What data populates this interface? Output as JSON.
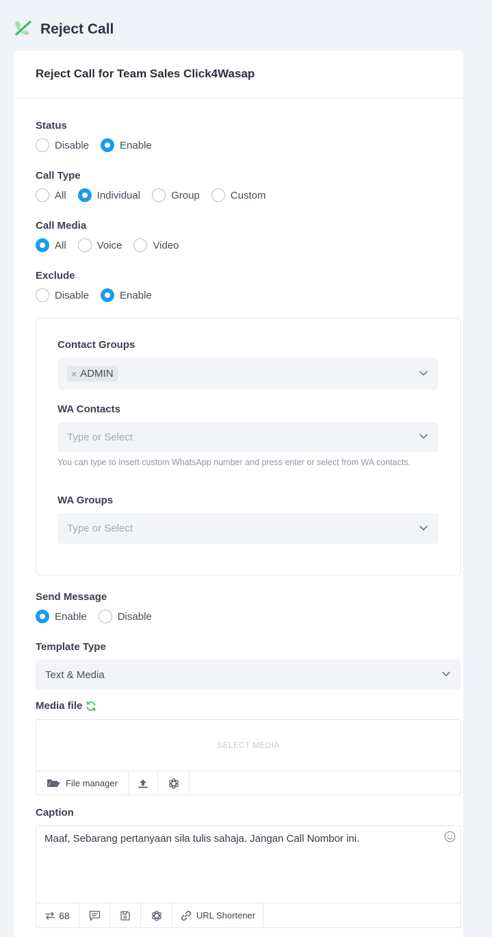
{
  "page": {
    "title": "Reject Call"
  },
  "card": {
    "title": "Reject Call for Team Sales Click4Wasap"
  },
  "status": {
    "label": "Status",
    "options": [
      "Disable",
      "Enable"
    ],
    "selected": "Enable"
  },
  "call_type": {
    "label": "Call Type",
    "options": [
      "All",
      "Individual",
      "Group",
      "Custom"
    ],
    "selected": "Individual"
  },
  "call_media": {
    "label": "Call Media",
    "options": [
      "All",
      "Voice",
      "Video"
    ],
    "selected": "All"
  },
  "exclude": {
    "label": "Exclude",
    "options": [
      "Disable",
      "Enable"
    ],
    "selected": "Enable",
    "contact_groups": {
      "label": "Contact Groups",
      "tags": [
        "ADMIN"
      ]
    },
    "wa_contacts": {
      "label": "WA Contacts",
      "placeholder": "Type or Select",
      "hint": "You can type to insert custom WhatsApp number and press enter or select from WA contacts."
    },
    "wa_groups": {
      "label": "WA Groups",
      "placeholder": "Type or Select"
    }
  },
  "send_message": {
    "label": "Send Message",
    "options": [
      "Enable",
      "Disable"
    ],
    "selected": "Enable"
  },
  "template_type": {
    "label": "Template Type",
    "value": "Text & Media"
  },
  "media_file": {
    "label": "Media file",
    "select_text": "SELECT MEDIA",
    "file_manager_label": "File manager"
  },
  "caption": {
    "label": "Caption",
    "text": "Maaf, Sebarang pertanyaan sila tulis sahaja. Jangan Call Nombor ini.",
    "char_count": "68",
    "url_shortener_label": "URL Shortener"
  },
  "colors": {
    "accent": "#1a9bf0",
    "brand_green": "#4cc46e",
    "background": "#f0f3f7"
  }
}
